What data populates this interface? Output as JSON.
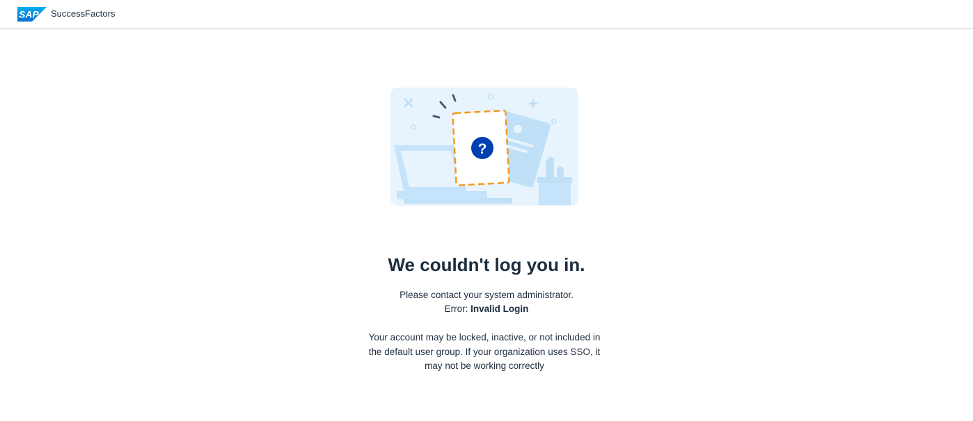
{
  "header": {
    "logo_text": "SAP",
    "product_name": "SuccessFactors",
    "brand_color": "#0a6ed1"
  },
  "illustration": {
    "icon": "question-mark-icon",
    "symbol": "?",
    "accent_color": "#0040b0",
    "frame_color": "#f39a1c",
    "background_color": "#e8f4fd"
  },
  "message": {
    "title": "We couldn't log you in.",
    "contact": "Please contact your system administrator.",
    "error_label": "Error:",
    "error_value": "Invalid Login",
    "explanation": "Your account may be locked, inactive, or not included in the default user group. If your organization uses SSO, it may not be working correctly"
  }
}
